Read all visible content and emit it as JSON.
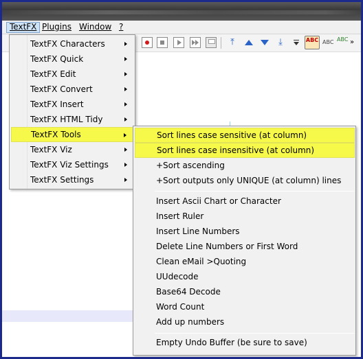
{
  "menubar": {
    "items": [
      {
        "label": "TextFX",
        "accel": "T"
      },
      {
        "label": "Plugins",
        "accel": "P"
      },
      {
        "label": "Window",
        "accel": "W"
      },
      {
        "label": "?",
        "accel": "?"
      }
    ]
  },
  "toolbar": {
    "icons": [
      "record-macro-icon",
      "stop-macro-icon",
      "play-macro-icon",
      "run-macro-multiple-icon",
      "save-macro-icon",
      "move-to-top-icon",
      "move-up-icon",
      "move-down-icon",
      "move-to-bottom-icon",
      "dropdown-icon",
      "spell-check-icon",
      "spell-check-options-icon",
      "spell-check-auto-icon",
      "toolbar-overflow-icon"
    ],
    "abc_label": "ABC",
    "abc2_label": "ABC",
    "abc3_label": "ABC"
  },
  "textfx_menu": {
    "items": [
      {
        "label": "TextFX Characters",
        "submenu": true
      },
      {
        "label": "TextFX Quick",
        "submenu": true
      },
      {
        "label": "TextFX Edit",
        "submenu": true
      },
      {
        "label": "TextFX Convert",
        "submenu": true
      },
      {
        "label": "TextFX Insert",
        "submenu": true
      },
      {
        "label": "TextFX HTML Tidy",
        "submenu": true
      },
      {
        "label": "TextFX Tools",
        "submenu": true,
        "highlighted": true
      },
      {
        "label": "TextFX Viz",
        "submenu": true
      },
      {
        "label": "TextFX Viz Settings",
        "submenu": true
      },
      {
        "label": "TextFX Settings",
        "submenu": true
      }
    ]
  },
  "tools_submenu": {
    "items": [
      {
        "label": "Sort lines case sensitive (at column)",
        "highlighted": true
      },
      {
        "label": "Sort lines case insensitive (at column)",
        "highlighted": true
      },
      {
        "label": "+Sort ascending"
      },
      {
        "label": "+Sort outputs only UNIQUE (at column) lines"
      },
      {
        "label": "Insert Ascii Chart or Character"
      },
      {
        "label": "Insert Ruler"
      },
      {
        "label": "Insert Line Numbers"
      },
      {
        "label": "Delete Line Numbers or First Word"
      },
      {
        "label": "Clean eMail >Quoting"
      },
      {
        "label": "UUdecode"
      },
      {
        "label": "Base64 Decode"
      },
      {
        "label": "Word Count"
      },
      {
        "label": "Add up numbers"
      },
      {
        "label": "Empty Undo Buffer (be sure to save)"
      }
    ]
  },
  "colors": {
    "highlight": "#f6f84a",
    "menu_bg": "#f1f1f1",
    "frame_border": "#1c2a8c"
  }
}
